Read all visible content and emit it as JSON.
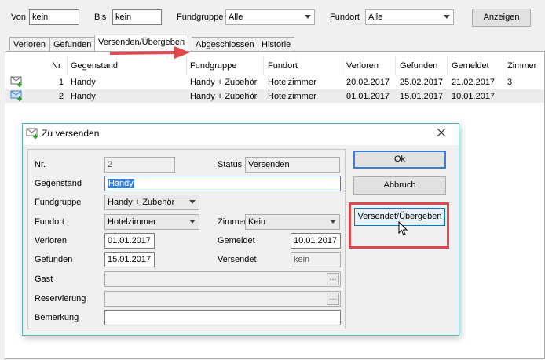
{
  "filter": {
    "von_label": "Von",
    "von_value": "kein",
    "bis_label": "Bis",
    "bis_value": "kein",
    "fundgruppe_label": "Fundgruppe",
    "fundgruppe_value": "Alle",
    "fundort_label": "Fundort",
    "fundort_value": "Alle",
    "anzeigen_label": "Anzeigen"
  },
  "tabs": [
    "Verloren",
    "Gefunden",
    "Versenden/Übergeben",
    "Abgeschlossen",
    "Historie"
  ],
  "table": {
    "headers": [
      "Nr",
      "Gegenstand",
      "Fundgruppe",
      "Fundort",
      "Verloren",
      "Gefunden",
      "Gemeldet",
      "Zimmer"
    ],
    "rows": [
      [
        "1",
        "Handy",
        "Handy + Zubehör",
        "Hotelzimmer",
        "20.02.2017",
        "25.02.2017",
        "21.02.2017",
        "3"
      ],
      [
        "2",
        "Handy",
        "Handy + Zubehör",
        "Hotelzimmer",
        "01.01.2017",
        "15.01.2017",
        "10.01.2017",
        ""
      ]
    ]
  },
  "dialog": {
    "title": "Zu versenden",
    "nr_label": "Nr.",
    "nr_value": "2",
    "status_label": "Status",
    "status_value": "Versenden",
    "gegenstand_label": "Gegenstand",
    "gegenstand_value": "Handy",
    "fundgruppe_label": "Fundgruppe",
    "fundgruppe_value": "Handy + Zubehör",
    "fundort_label": "Fundort",
    "fundort_value": "Hotelzimmer",
    "zimmer_label": "Zimmer",
    "zimmer_value": "Kein",
    "verloren_label": "Verloren",
    "verloren_value": "01.01.2017",
    "gemeldet_label": "Gemeldet",
    "gemeldet_value": "10.01.2017",
    "gefunden_label": "Gefunden",
    "gefunden_value": "15.01.2017",
    "versendet_label": "Versendet",
    "versendet_value": "kein",
    "gast_label": "Gast",
    "reservierung_label": "Reservierung",
    "bemerkung_label": "Bemerkung",
    "ok_label": "Ok",
    "abbruch_label": "Abbruch",
    "versendet_button_label": "Versendet/Übergeben",
    "ellipsis": "..."
  },
  "colors": {
    "highlight_red": "#e0474c",
    "selection_blue": "#3a7fd5",
    "accent_button": "#cce4f7"
  }
}
